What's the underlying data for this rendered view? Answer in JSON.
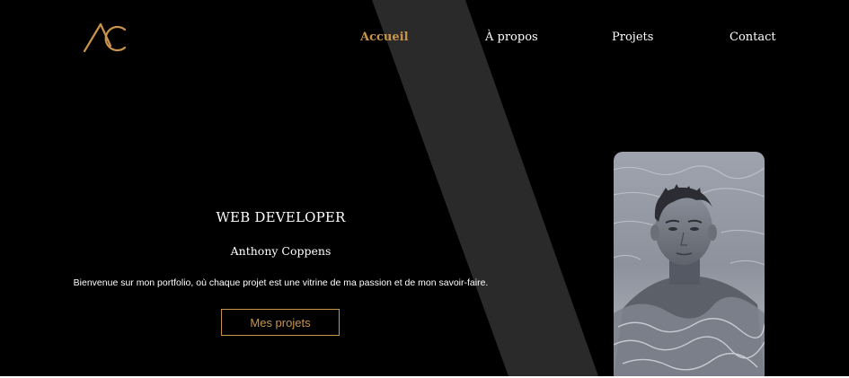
{
  "header": {
    "logo_alt": "AC",
    "nav": [
      {
        "label": "Accueil",
        "active": true
      },
      {
        "label": "À propos",
        "active": false
      },
      {
        "label": "Projets",
        "active": false
      },
      {
        "label": "Contact",
        "active": false
      }
    ]
  },
  "hero": {
    "title": "WEB DEVELOPER",
    "name": "Anthony Coppens",
    "tagline": "Bienvenue sur mon portfolio, où chaque projet est une vitrine de ma passion et de mon savoir-faire.",
    "cta_label": "Mes projets"
  },
  "colors": {
    "background": "#000000",
    "accent": "#c9954a",
    "band": "#2a2a2a",
    "text": "#ffffff"
  }
}
